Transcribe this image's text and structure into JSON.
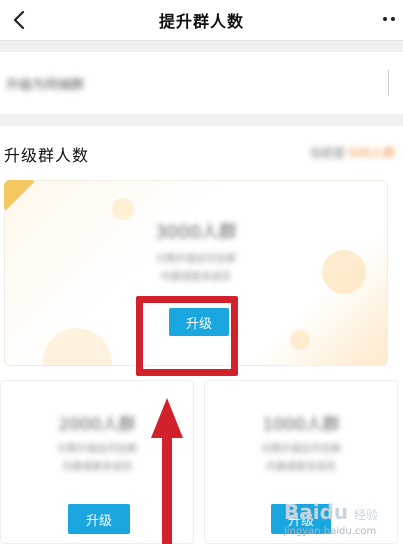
{
  "header": {
    "title": "提升群人数"
  },
  "settings_row": {
    "blurred_text": "升级为同城群"
  },
  "section": {
    "title": "升级群人数",
    "right_text_a": "当前是",
    "right_text_b": "500人群"
  },
  "plans": {
    "main": {
      "amount": "3000人群",
      "desc1": "付费升级后可在群",
      "desc2": "内邀请更多成员",
      "button": "升级"
    },
    "left": {
      "amount": "2000人群",
      "desc1": "付费升级后可在群",
      "desc2": "内邀请更多成员",
      "button": "升级"
    },
    "right": {
      "amount": "1000人群",
      "desc1": "付费升级后可在群",
      "desc2": "内邀请更多成员",
      "button": "升级"
    }
  },
  "watermark": {
    "brand": "Baidu",
    "sub": "经验",
    "url": "jingyan.baidu.com"
  },
  "colors": {
    "button_blue": "#1aa6df",
    "annotation_red": "#d3212c"
  }
}
